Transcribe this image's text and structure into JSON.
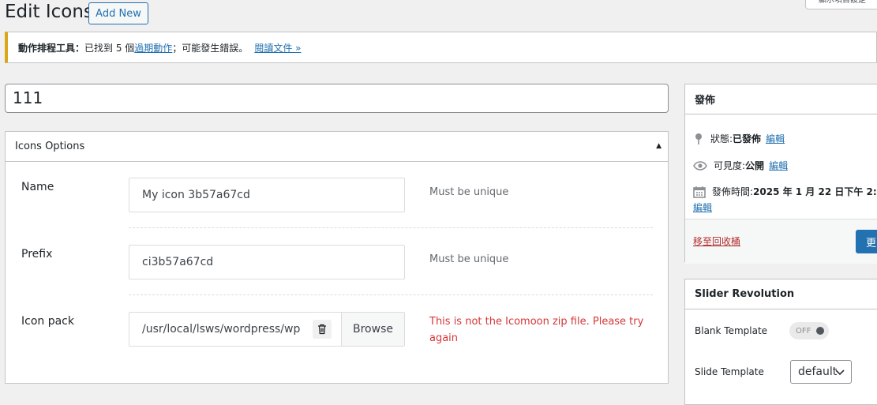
{
  "header": {
    "title": "Edit Icons",
    "add_new": "Add New",
    "screen_options": "顯示項目設定"
  },
  "notice": {
    "bold": "動作排程工具：",
    "text_a": "已找到 5 個",
    "link1": "過期動作",
    "text_b": "；可能發生錯誤。",
    "link2": "閱讀文件 »"
  },
  "post_title": "111",
  "options": {
    "heading": "Icons Options",
    "toggle": "▲",
    "name_label": "Name",
    "name_value": "My icon 3b57a67cd",
    "name_hint": "Must be unique",
    "prefix_label": "Prefix",
    "prefix_value": "ci3b57a67cd",
    "prefix_hint": "Must be unique",
    "pack_label": "Icon pack",
    "pack_value": "/usr/local/lsws/wordpress/wp",
    "browse": "Browse",
    "error": "This is not the Icomoon zip file. Please try again"
  },
  "publish": {
    "heading": "發佈",
    "status_label": "狀態: ",
    "status_value": "已發佈",
    "visibility_label": "可見度: ",
    "visibility_value": "公開",
    "date_label": "發佈時間: ",
    "date_value": "2025 年 1 月 22 日下午 2:",
    "edit": "編輯",
    "trash": "移至回收桶",
    "update": "更"
  },
  "slider": {
    "heading": "Slider Revolution",
    "blank_label": "Blank Template",
    "blank_toggle": "OFF",
    "slide_label": "Slide Template",
    "slide_value": "default"
  }
}
